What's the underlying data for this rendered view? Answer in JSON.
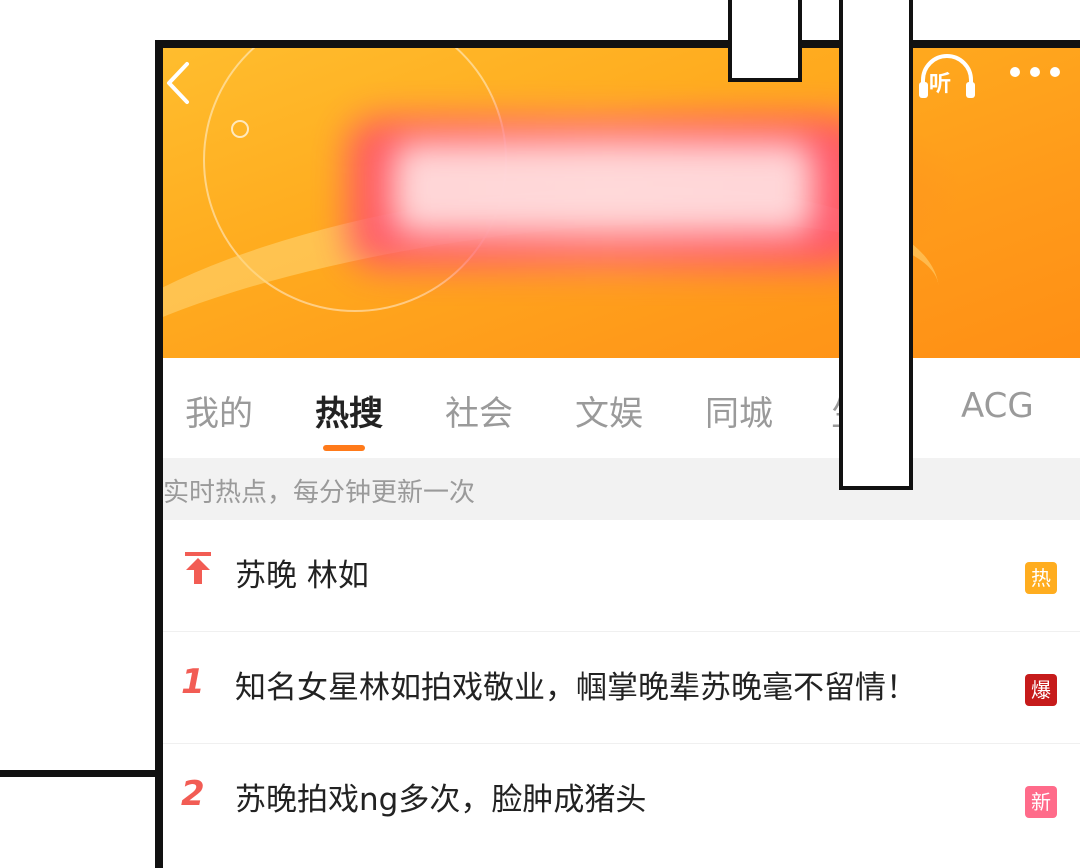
{
  "header": {
    "back_icon": "chevron-left-icon",
    "listen_label": "听",
    "more_icon": "more-dots-icon",
    "banner_colors": [
      "#ffbd2e",
      "#ff8e14"
    ]
  },
  "tabs": [
    {
      "label": "我的",
      "active": false
    },
    {
      "label": "热搜",
      "active": true
    },
    {
      "label": "社会",
      "active": false
    },
    {
      "label": "文娱",
      "active": false
    },
    {
      "label": "同城",
      "active": false
    },
    {
      "label": "生",
      "active": false
    },
    {
      "label": "ACG",
      "active": false
    }
  ],
  "subtitle": "实时热点，每分钟更新一次",
  "list": [
    {
      "rank": "↑",
      "rank_icon": "pin-top-icon",
      "text": "苏晚 林如",
      "badge": "热",
      "badge_color": "#ffad1f"
    },
    {
      "rank": "1",
      "text": "知名女星林如拍戏敬业，帼掌晚辈苏晚毫不留情！",
      "badge": "爆",
      "badge_color": "#d81e1e"
    },
    {
      "rank": "2",
      "text": "苏晚拍戏ng多次，脸肿成猪头",
      "badge": "新",
      "badge_color": "#ff6b8a"
    }
  ]
}
